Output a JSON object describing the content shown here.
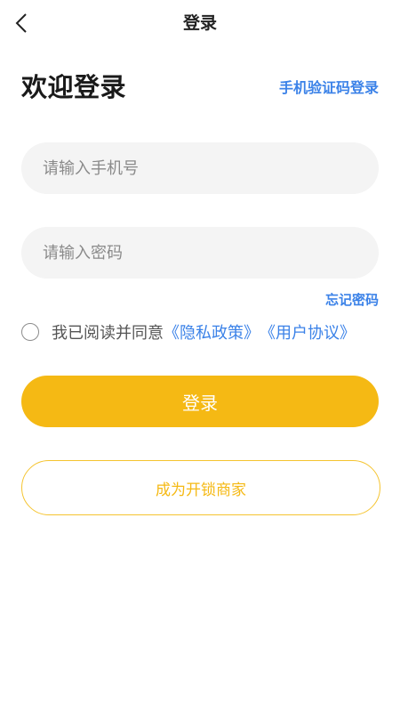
{
  "header": {
    "title": "登录",
    "back_icon": "chevron-left-icon"
  },
  "welcome": {
    "title": "欢迎登录",
    "sms_login_link": "手机验证码登录"
  },
  "form": {
    "phone_placeholder": "请输入手机号",
    "phone_value": "",
    "password_placeholder": "请输入密码",
    "password_value": "",
    "forgot_password": "忘记密码"
  },
  "agreement": {
    "checked": false,
    "text": "我已阅读并同意",
    "privacy_link": "《隐私政策》",
    "terms_link": "《用户协议》"
  },
  "actions": {
    "login_label": "登录",
    "become_merchant_label": "成为开锁商家"
  },
  "colors": {
    "accent": "#f5b914",
    "link": "#3b82e8",
    "input_bg": "#f4f4f4"
  }
}
